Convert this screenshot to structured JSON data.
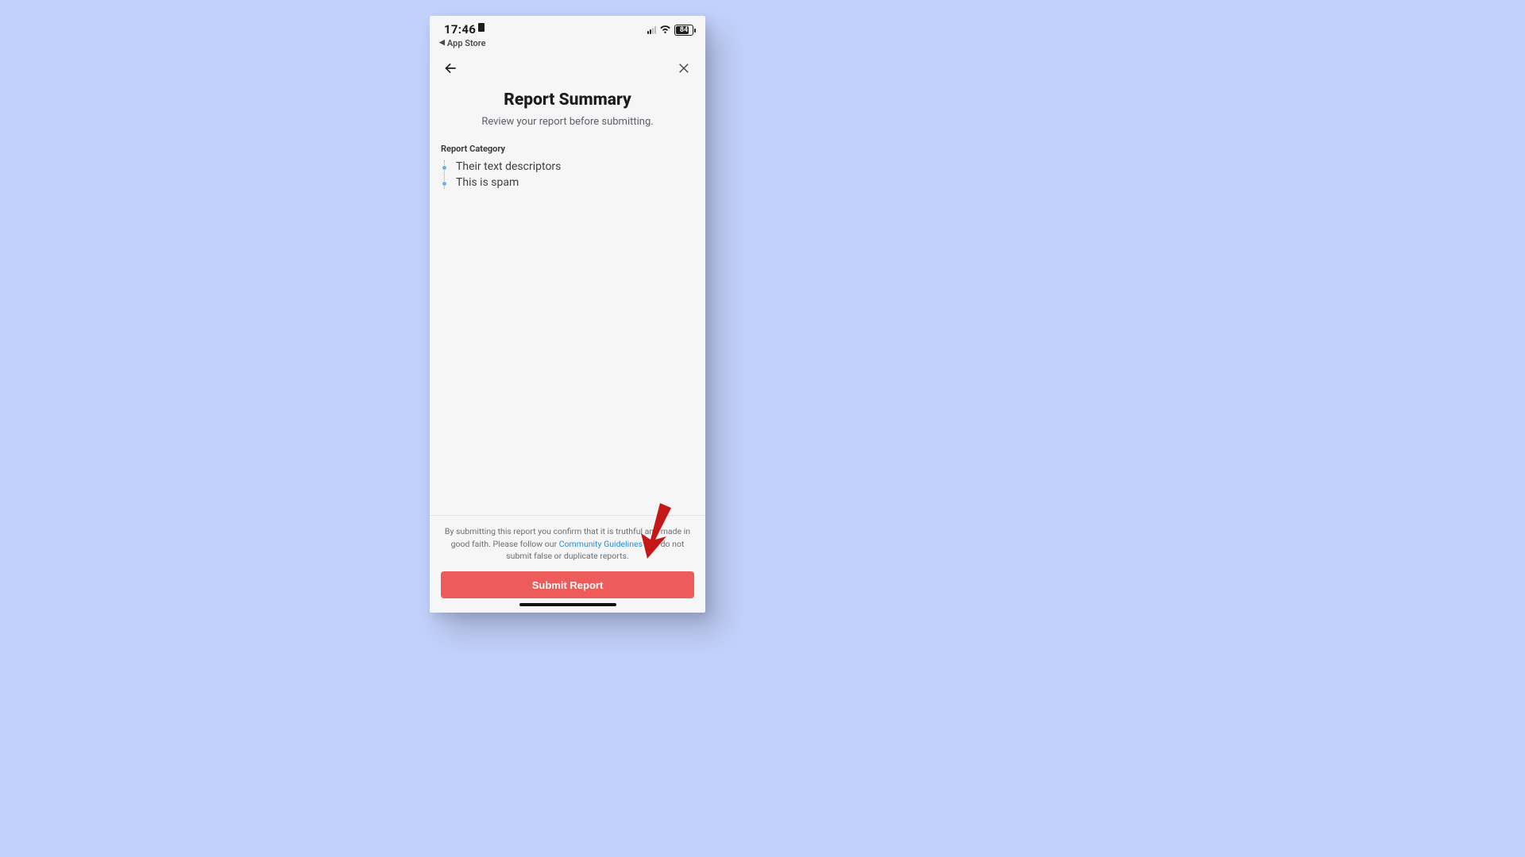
{
  "statusbar": {
    "time": "17:46",
    "backapp_label": "App Store",
    "battery_pct": "84"
  },
  "header": {
    "title": "Report Summary",
    "subtitle": "Review your report before submitting."
  },
  "category": {
    "label": "Report Category",
    "items": [
      "Their text descriptors",
      "This is spam"
    ]
  },
  "footer": {
    "disclaimer_pre": "By submitting this report you confirm that it is truthful and made in good faith. Please follow our ",
    "guidelines_link": "Community Guidelines",
    "disclaimer_post": " and do not submit false or duplicate reports.",
    "submit_label": "Submit Report"
  }
}
